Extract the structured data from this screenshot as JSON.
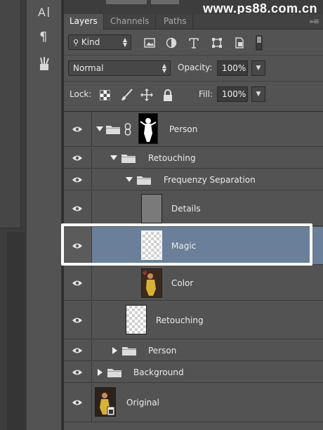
{
  "watermark": "www.ps88.com.cn",
  "tabs": [
    {
      "label": "Layers",
      "active": true
    },
    {
      "label": "Channels",
      "active": false
    },
    {
      "label": "Paths",
      "active": false
    }
  ],
  "filter": {
    "kind_label": "Kind",
    "icons": [
      "image-filter-icon",
      "adjustment-filter-icon",
      "type-filter-icon",
      "shape-filter-icon",
      "smart-object-filter-icon",
      "filter-toggle-icon"
    ]
  },
  "blend": {
    "mode": "Normal",
    "opacity_label": "Opacity:",
    "opacity_value": "100%"
  },
  "lock": {
    "label": "Lock:",
    "fill_label": "Fill:",
    "fill_value": "100%",
    "icons": [
      "lock-transparent-icon",
      "lock-paint-icon",
      "lock-position-icon",
      "lock-all-icon"
    ]
  },
  "tools": [
    "type-tool-icon",
    "paragraph-icon",
    "brush-tool-icon"
  ],
  "layers": [
    {
      "name": "Person",
      "kind": "group-masked",
      "expanded": true,
      "selected": false
    },
    {
      "name": "Retouching",
      "kind": "group",
      "expanded": true,
      "selected": false
    },
    {
      "name": "Frequenzy Separation",
      "kind": "group",
      "expanded": true,
      "selected": false
    },
    {
      "name": "Details",
      "kind": "layer",
      "selected": false
    },
    {
      "name": "Magic",
      "kind": "layer-transparent",
      "selected": true
    },
    {
      "name": "Color",
      "kind": "layer-photo",
      "selected": false
    },
    {
      "name": "Retouching",
      "kind": "layer-transparent",
      "selected": false
    },
    {
      "name": "Person",
      "kind": "group",
      "expanded": false,
      "selected": false
    },
    {
      "name": "Background",
      "kind": "group",
      "expanded": false,
      "selected": false
    },
    {
      "name": "Original",
      "kind": "smart-object",
      "selected": false
    }
  ],
  "colors": {
    "selected_row": "#6a7f99",
    "panel_bg": "#535353",
    "highlight_frame": "#ffffff"
  }
}
